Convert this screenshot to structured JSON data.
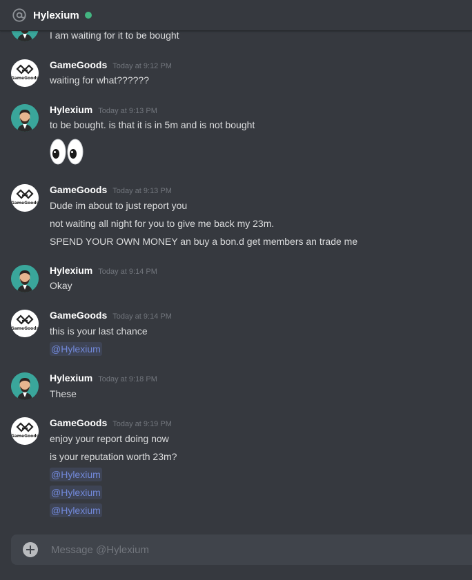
{
  "header": {
    "channel_name": "Hylexium",
    "status": "online",
    "status_color": "#43b581",
    "icon": "at-sign-icon"
  },
  "users": {
    "gamegoods": {
      "name": "GameGoods",
      "avatar_text": "GameGoods",
      "avatar_icon": "chain-link-logo"
    },
    "hylexium": {
      "name": "Hylexium",
      "avatar_icon": "bearded-man-avatar"
    }
  },
  "messages": [
    {
      "author": "Hylexium",
      "partial": true,
      "lines": [
        "I am waiting for it to be bought"
      ]
    },
    {
      "author": "GameGoods",
      "timestamp": "Today at 9:12 PM",
      "lines": [
        "waiting for what??????"
      ]
    },
    {
      "author": "Hylexium",
      "timestamp": "Today at 9:13 PM",
      "lines": [
        "to be bought. is that it is in 5m and is not bought"
      ],
      "emoji": "eyes"
    },
    {
      "author": "GameGoods",
      "timestamp": "Today at 9:13 PM",
      "lines": [
        "Dude im about to just report you",
        "not waiting all night for you to give me back my 23m.",
        "SPEND YOUR OWN MONEY an buy a bon.d get members an trade me"
      ]
    },
    {
      "author": "Hylexium",
      "timestamp": "Today at 9:14 PM",
      "lines": [
        "Okay"
      ]
    },
    {
      "author": "GameGoods",
      "timestamp": "Today at 9:14 PM",
      "lines": [
        "this is your last chance"
      ],
      "mentions": [
        "@Hylexium"
      ]
    },
    {
      "author": "Hylexium",
      "timestamp": "Today at 9:18 PM",
      "lines": [
        "These"
      ]
    },
    {
      "author": "GameGoods",
      "timestamp": "Today at 9:19 PM",
      "lines": [
        "enjoy your report doing now",
        "is your reputation worth 23m?"
      ],
      "mentions": [
        "@Hylexium",
        "@Hylexium",
        "@Hylexium"
      ]
    }
  ],
  "composer": {
    "placeholder": "Message @Hylexium",
    "add_icon": "plus-circle-icon"
  },
  "colors": {
    "background": "#36393f",
    "mention": "#7289da",
    "input_bg": "#40444b"
  }
}
